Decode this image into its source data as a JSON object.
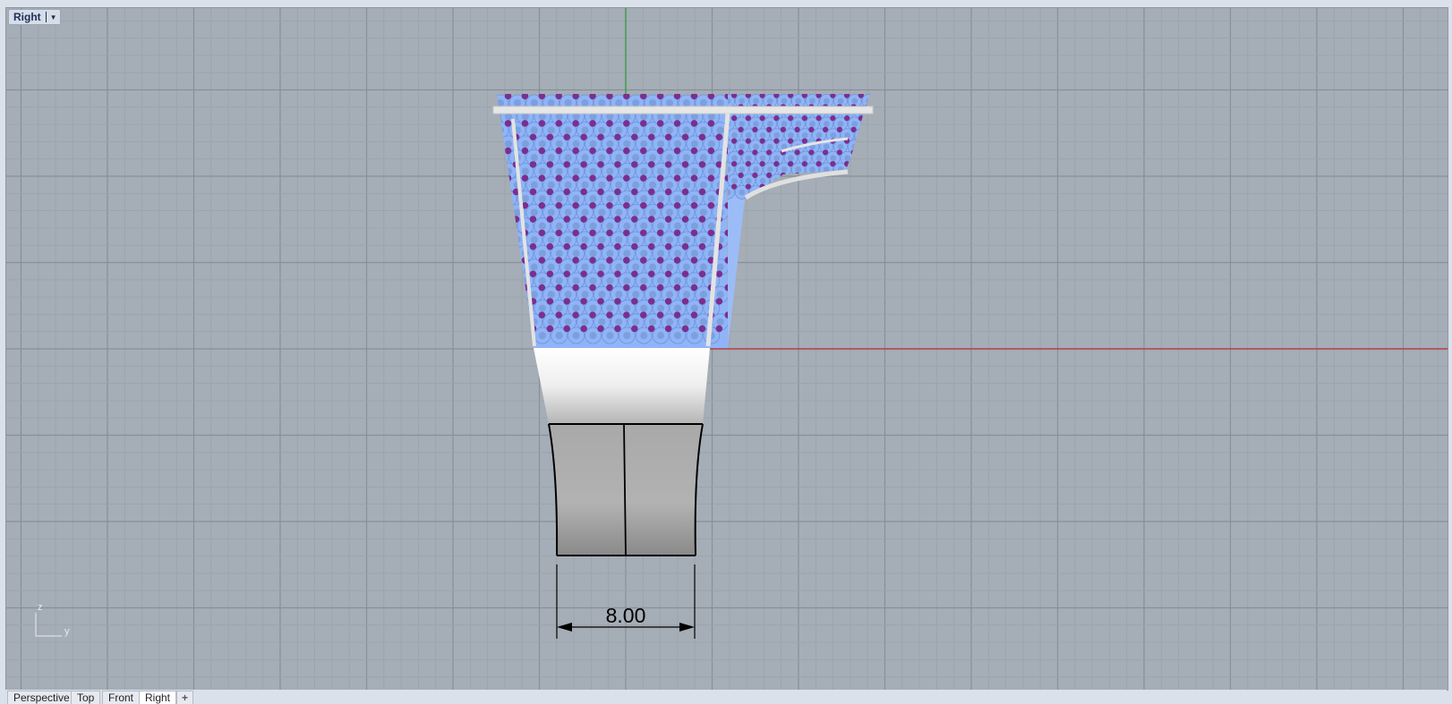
{
  "viewport": {
    "name": "Right",
    "dimension_text": "8.00",
    "axis_z": "z",
    "axis_y": "y"
  },
  "tabs": [
    {
      "label": "Perspective"
    },
    {
      "label": "Top"
    },
    {
      "label": "Front"
    },
    {
      "label": "Right",
      "active": true
    }
  ],
  "add_tab_label": "+",
  "colors": {
    "background": "#a5adb6",
    "grid_minor": "#9aa2ab",
    "grid_major": "#878f99",
    "x_axis": "#b83232",
    "z_axis": "#2f9a34",
    "gem": "#8fb4f7",
    "prong": "#7a2f8f"
  },
  "icons": [
    "dropdown-arrow-icon",
    "add-tab-icon"
  ]
}
